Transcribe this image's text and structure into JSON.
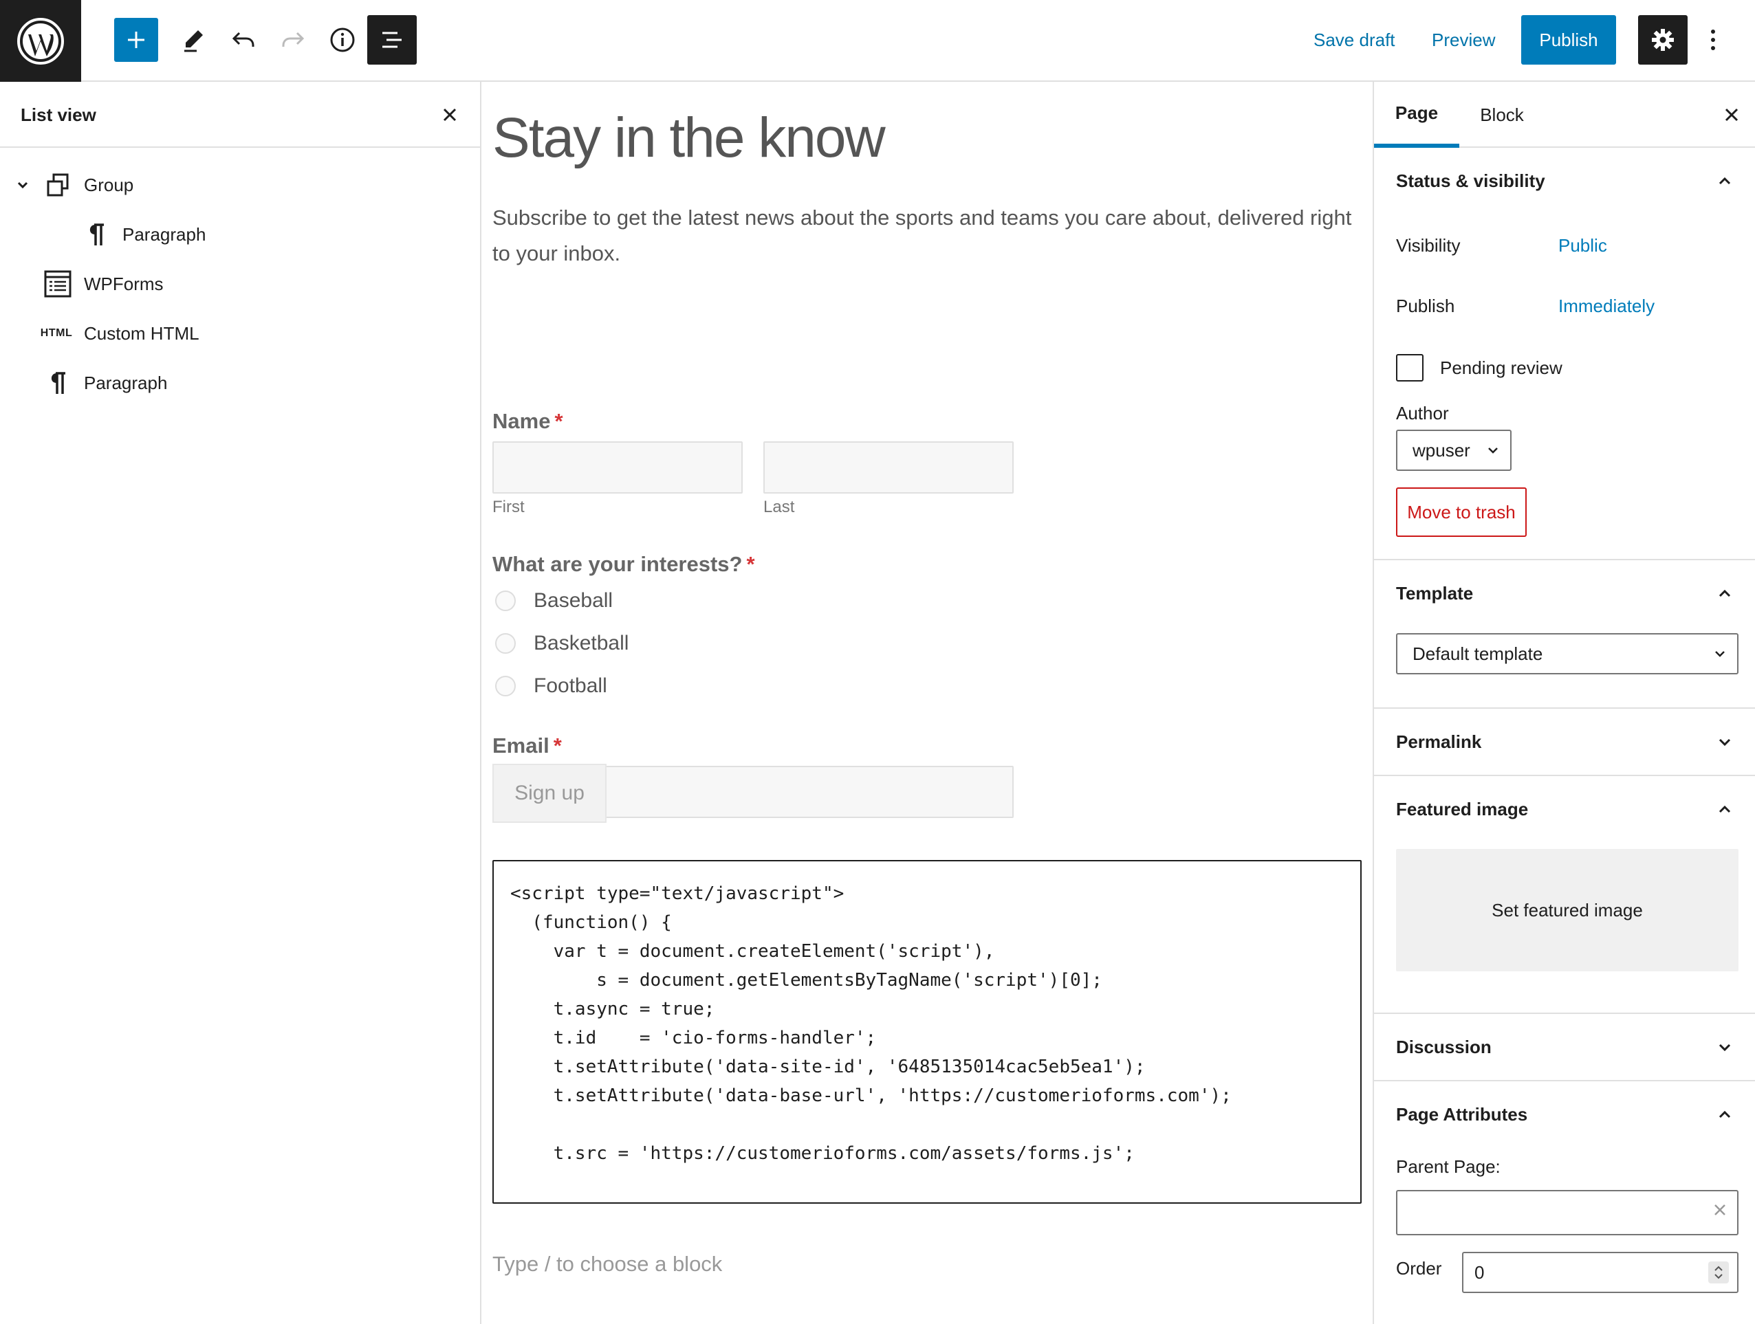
{
  "toolbar": {
    "logo_icon": "wordpress-logo-icon",
    "save_draft": "Save draft",
    "preview": "Preview",
    "publish": "Publish",
    "accent_color": "#007cba"
  },
  "list_view": {
    "title": "List view",
    "items": [
      {
        "label": "Group",
        "icon": "group-icon"
      },
      {
        "label": "Paragraph",
        "icon": "paragraph-icon"
      },
      {
        "label": "WPForms",
        "icon": "wpforms-icon"
      },
      {
        "label": "Custom HTML",
        "icon": "html-icon",
        "icon_text": "HTML"
      },
      {
        "label": "Paragraph",
        "icon": "paragraph-icon"
      }
    ]
  },
  "editor": {
    "title": "Stay in the know",
    "intro": "Subscribe to get the latest news about the sports and teams you care about, delivered right to your inbox.",
    "form": {
      "name_label": "Name",
      "required_mark": "*",
      "first_sublabel": "First",
      "last_sublabel": "Last",
      "interests_label": "What are your interests?",
      "interests": [
        "Baseball",
        "Basketball",
        "Football"
      ],
      "email_label": "Email",
      "submit_label": "Sign up"
    },
    "code_lines": [
      "<script type=\"text/javascript\">",
      "  (function() {",
      "    var t = document.createElement('script'),",
      "        s = document.getElementsByTagName('script')[0];",
      "    t.async = true;",
      "    t.id    = 'cio-forms-handler';",
      "    t.setAttribute('data-site-id', '6485135014cac5eb5ea1');",
      "    t.setAttribute('data-base-url', 'https://customerioforms.com');",
      "",
      "    t.src = 'https://customerioforms.com/assets/forms.js';"
    ],
    "appender_placeholder": "Type / to choose a block"
  },
  "sidebar": {
    "tabs": {
      "page": "Page",
      "block": "Block"
    },
    "status_visibility": {
      "title": "Status & visibility",
      "visibility_label": "Visibility",
      "visibility_value": "Public",
      "publish_label": "Publish",
      "publish_value": "Immediately",
      "pending_review": "Pending review",
      "author_label": "Author",
      "author_value": "wpuser",
      "trash": "Move to trash"
    },
    "template": {
      "title": "Template",
      "value": "Default template"
    },
    "permalink": {
      "title": "Permalink"
    },
    "featured_image": {
      "title": "Featured image",
      "button": "Set featured image"
    },
    "discussion": {
      "title": "Discussion"
    },
    "page_attributes": {
      "title": "Page Attributes",
      "parent_label": "Parent Page:",
      "order_label": "Order",
      "order_value": "0"
    }
  }
}
